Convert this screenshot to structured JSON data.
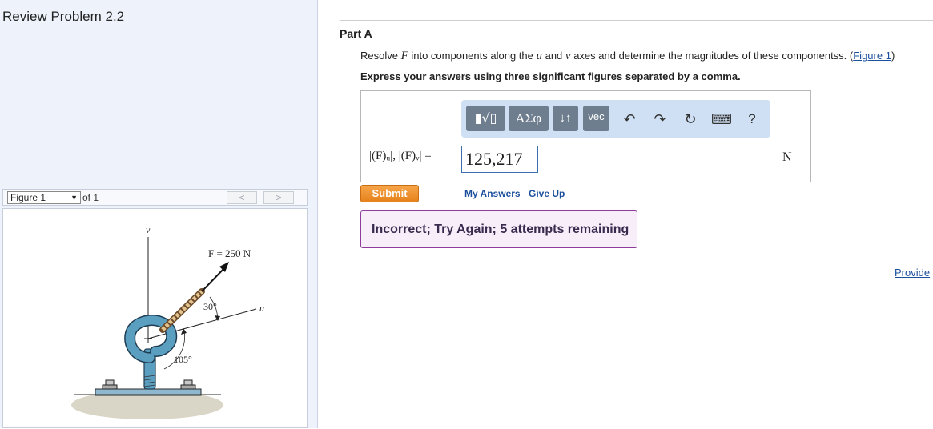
{
  "problem": {
    "title": "Review Problem 2.2"
  },
  "figure_nav": {
    "selected": "Figure 1",
    "of_label": "of 1",
    "prev_glyph": "<",
    "next_glyph": ">"
  },
  "figure": {
    "force_label": "F = 250 N",
    "v_axis_label": "v",
    "u_axis_label": "u",
    "angle_1": "30°",
    "angle_2": "105°"
  },
  "part": {
    "label": "Part A",
    "prompt_prefix": "Resolve ",
    "prompt_var_F": "F",
    "prompt_mid1": " into components along the ",
    "prompt_var_u": "u",
    "prompt_mid2": " and ",
    "prompt_var_v": "v",
    "prompt_mid3": " axes and determine the magnitudes of these componentss. (",
    "prompt_link": "Figure 1",
    "prompt_suffix": ")",
    "instruction": "Express your answers using three significant figures separated by a comma."
  },
  "toolbar": {
    "template_glyph": "▮√▯",
    "greek_glyph": "ΑΣφ",
    "arrows_glyph": "↓↑",
    "vec_label": "vec",
    "undo_glyph": "↶",
    "redo_glyph": "↷",
    "reset_glyph": "↻",
    "keyboard_glyph": "⌨",
    "help_glyph": "?"
  },
  "answer": {
    "math_label": "|(F)ᵤ|, |(F)ᵥ| =",
    "value": "125,217",
    "unit": "N"
  },
  "actions": {
    "submit": "Submit",
    "my_answers": "My Answers",
    "give_up": "Give Up"
  },
  "feedback": {
    "message": "Incorrect; Try Again; 5 attempts remaining"
  },
  "provide_feedback_link": "Provide",
  "colors": {
    "submit": "#f08c25",
    "feedback_border": "#8e3b9b",
    "link": "#1a4f9c",
    "toolbar_bg": "#cfe0f5"
  }
}
